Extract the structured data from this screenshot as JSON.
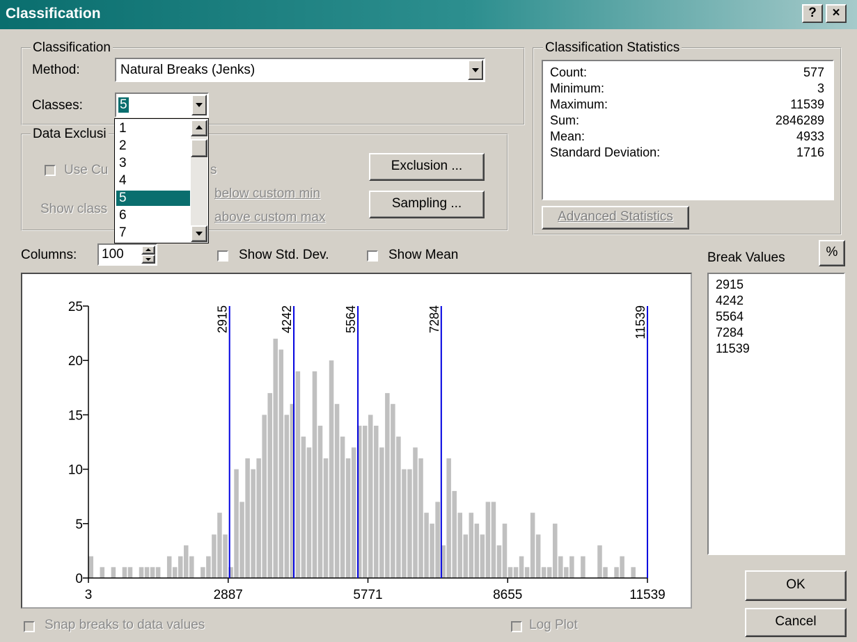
{
  "title": "Classification",
  "titlebar_buttons": {
    "help": "?",
    "close": "×"
  },
  "classification_group": {
    "legend": "Classification",
    "method_label": "Method:",
    "method_value": "Natural Breaks (Jenks)",
    "classes_label": "Classes:",
    "classes_value": "5",
    "classes_options": [
      "1",
      "2",
      "3",
      "4",
      "5",
      "6",
      "7"
    ],
    "classes_selected": "5"
  },
  "data_exclusion_group": {
    "legend": "Data Exclusi",
    "use_custom_label": "Use Cu",
    "use_custom_suffix": "s",
    "show_class_label": "Show class",
    "below_label": "below custom min",
    "above_label": "above custom max",
    "exclusion_button": "Exclusion ...",
    "sampling_button": "Sampling ..."
  },
  "stats_group": {
    "legend": "Classification Statistics",
    "rows": [
      {
        "label": "Count:",
        "value": "577"
      },
      {
        "label": "Minimum:",
        "value": "3"
      },
      {
        "label": "Maximum:",
        "value": "11539"
      },
      {
        "label": "Sum:",
        "value": "2846289"
      },
      {
        "label": "Mean:",
        "value": "4933"
      },
      {
        "label": "Standard Deviation:",
        "value": "1716"
      }
    ],
    "advanced_button": "Advanced Statistics"
  },
  "columns": {
    "label": "Columns:",
    "value": "100"
  },
  "show_std_dev": {
    "label": "Show Std. Dev.",
    "checked": false
  },
  "show_mean": {
    "label": "Show Mean",
    "checked": false
  },
  "break_values": {
    "label": "Break Values",
    "percent_button": "%",
    "items": [
      "2915",
      "4242",
      "5564",
      "7284",
      "11539"
    ]
  },
  "snap_breaks": {
    "label": "Snap breaks to data values",
    "checked": false
  },
  "log_plot": {
    "label": "Log Plot",
    "checked": false
  },
  "ok_button": "OK",
  "cancel_button": "Cancel",
  "colors": {
    "titlebar": "#0a6e6e",
    "bars": "#c0c0c0",
    "break_lines": "#0000e0",
    "selection": "#0a6e6e"
  },
  "chart_data": {
    "type": "bar",
    "xlim": [
      3,
      11539
    ],
    "ylim": [
      0,
      25
    ],
    "x_ticks": [
      "3",
      "2887",
      "5771",
      "8655",
      "11539"
    ],
    "y_ticks": [
      "0",
      "5",
      "10",
      "15",
      "20",
      "25"
    ],
    "break_lines": [
      "2915",
      "4242",
      "5564",
      "7284",
      "11539"
    ],
    "values": [
      2,
      0,
      1,
      0,
      1,
      0,
      1,
      1,
      0,
      1,
      1,
      1,
      1,
      0,
      2,
      1,
      2,
      3,
      2,
      0,
      1,
      2,
      4,
      6,
      4,
      1,
      10,
      7,
      11,
      10,
      11,
      15,
      17,
      22,
      21,
      15,
      16,
      19,
      13,
      12,
      19,
      14,
      11,
      20,
      16,
      13,
      11,
      12,
      14,
      14,
      15,
      14,
      12,
      17,
      16,
      13,
      10,
      10,
      12,
      11,
      6,
      5,
      7,
      3,
      11,
      8,
      6,
      4,
      6,
      5,
      4,
      7,
      7,
      3,
      5,
      1,
      1,
      2,
      1,
      6,
      4,
      1,
      1,
      5,
      2,
      1,
      2,
      0,
      2,
      0,
      0,
      3,
      1,
      0,
      1,
      2,
      0,
      1,
      0,
      0
    ]
  }
}
